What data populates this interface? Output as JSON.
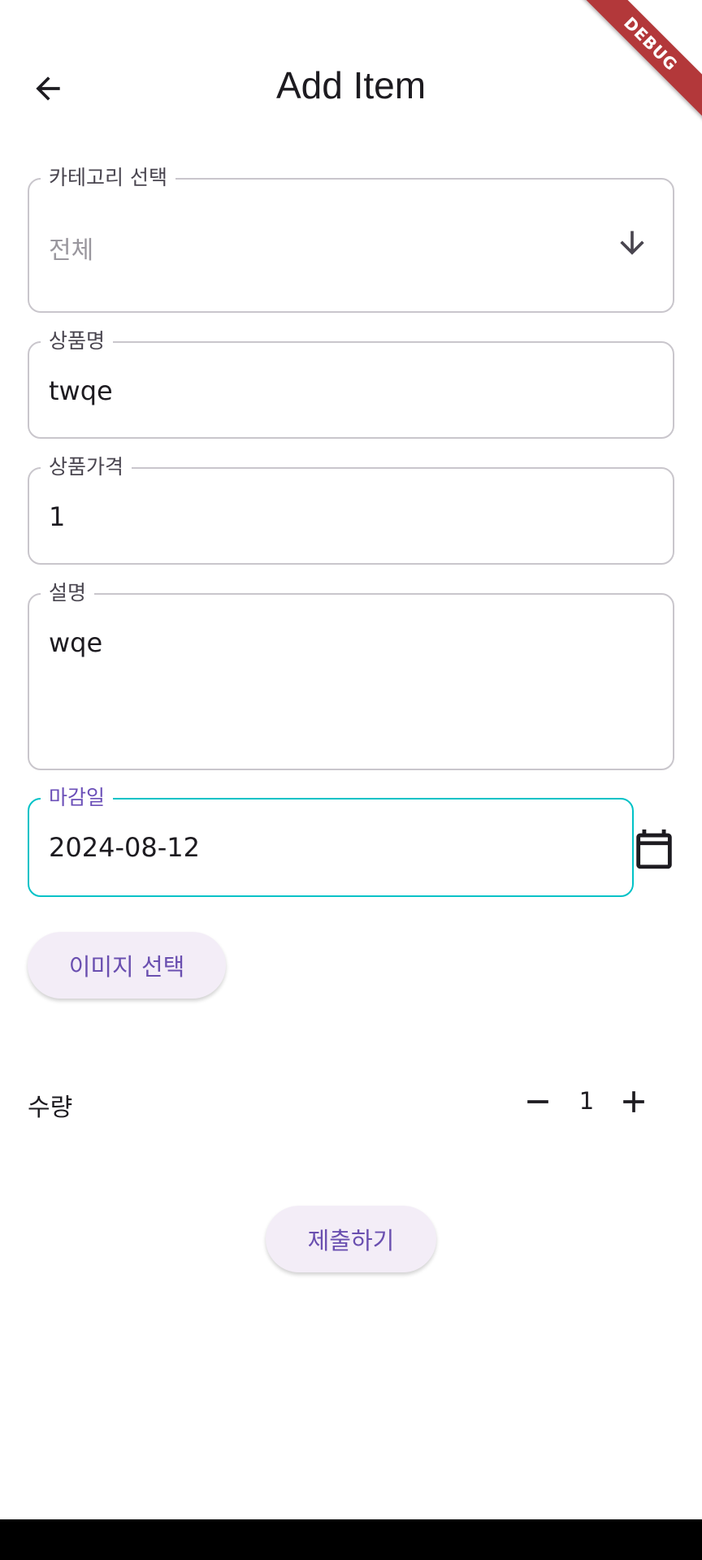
{
  "app_bar": {
    "title": "Add Item",
    "back_icon": "arrow-back-icon"
  },
  "debug_banner": "DEBUG",
  "form": {
    "category": {
      "label": "카테고리 선택",
      "placeholder": "전체",
      "icon": "arrow-down-icon"
    },
    "name": {
      "label": "상품명",
      "value": "twqe"
    },
    "price": {
      "label": "상품가격",
      "value": "1"
    },
    "description": {
      "label": "설명",
      "value": "wqe"
    },
    "deadline": {
      "label": "마감일",
      "value": "2024-08-12",
      "icon": "calendar-icon"
    },
    "image_button": "이미지 선택",
    "quantity": {
      "label": "수량",
      "value": "1",
      "decrement_icon": "minus-icon",
      "increment_icon": "plus-icon"
    },
    "submit_button": "제출하기"
  },
  "colors": {
    "focus_border": "#00c2c7",
    "focus_label": "#6b4fb8",
    "button_bg": "#f3edf7",
    "button_text": "#6a4fb0",
    "debug_banner": "#b3383a"
  }
}
